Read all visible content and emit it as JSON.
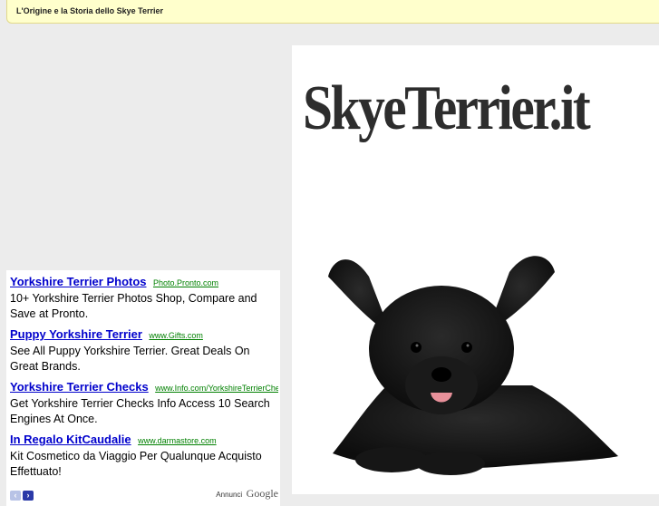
{
  "header": {
    "title": "L'Origine e la Storia dello Skye Terrier"
  },
  "ads": [
    {
      "title": "Yorkshire Terrier Photos",
      "url": "Photo.Pronto.com",
      "desc": "10+ Yorkshire Terrier Photos Shop, Compare and Save at Pronto."
    },
    {
      "title": "Puppy Yorkshire Terrier",
      "url": "www.Gifts.com",
      "desc": "See All Puppy Yorkshire Terrier. Great Deals On Great Brands."
    },
    {
      "title": "Yorkshire Terrier Checks",
      "url": "www.Info.com/YorkshireTerrierChe",
      "desc": "Get Yorkshire Terrier Checks Info Access 10 Search Engines At Once."
    },
    {
      "title": "In Regalo KitCaudalie",
      "url": "www.darmastore.com",
      "desc": "Kit Cosmetico da Viaggio Per Qualunque Acquisto Effettuato!"
    }
  ],
  "ad_footer": {
    "label": "Annunci",
    "logo": "Google",
    "prev_icon": "‹",
    "next_icon": "›"
  },
  "site": {
    "logo_text": "SkyeTerrier.it"
  },
  "colors": {
    "ad_title": "#0000cc",
    "ad_url": "#008000",
    "topbar_bg": "#ffffcc"
  }
}
